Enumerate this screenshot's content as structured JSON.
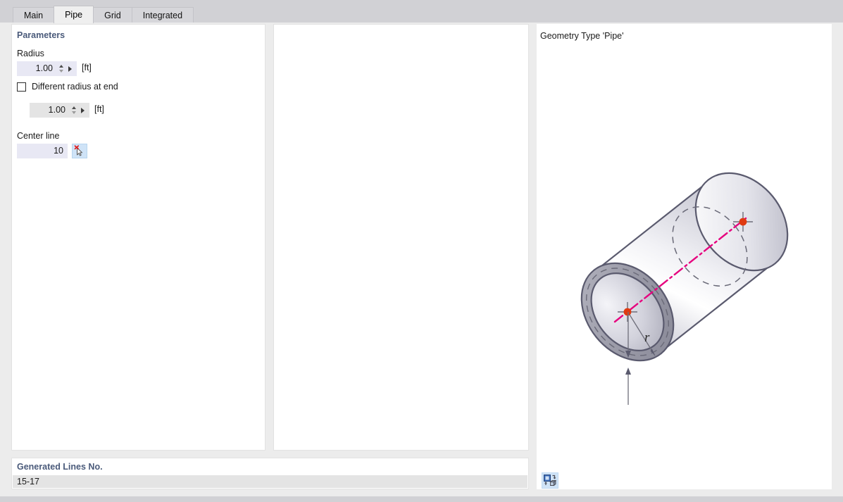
{
  "tabs": [
    {
      "label": "Main",
      "active": false
    },
    {
      "label": "Pipe",
      "active": true
    },
    {
      "label": "Grid",
      "active": false
    },
    {
      "label": "Integrated",
      "active": false
    }
  ],
  "parameters": {
    "section_title": "Parameters",
    "radius": {
      "label": "Radius",
      "value": "1.00",
      "unit": "[ft]",
      "enabled": true
    },
    "different_radius_at_end": {
      "label": "Different radius at end",
      "checked": false
    },
    "radius_end": {
      "value": "1.00",
      "unit": "[ft]",
      "enabled": false
    },
    "center_line": {
      "label": "Center line",
      "value": "10",
      "pick_icon": "pick-cursor-icon"
    }
  },
  "generated_lines": {
    "title": "Generated Lines No.",
    "value": "15-17"
  },
  "preview": {
    "caption": "Geometry Type 'Pipe'",
    "radius_label": "r",
    "view_toggle_icon": "render-view-toggle-icon"
  },
  "colors": {
    "accent_heading": "#4a5a7a",
    "field_active": "#e8e8f4",
    "field_disabled": "#e4e4e4",
    "button_highlight": "#cfe3f7",
    "centerline": "#e6007e",
    "node_marker": "#e03a10",
    "pipe_outline": "#5a5a6e",
    "window_chrome": "#d1d1d5"
  }
}
